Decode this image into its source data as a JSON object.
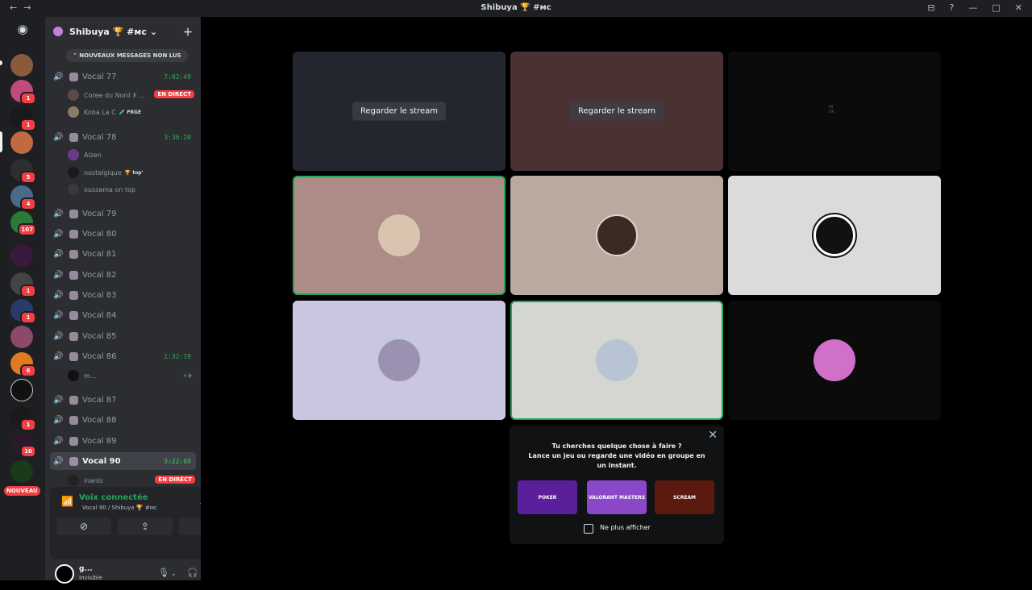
{
  "window": {
    "title": "Shibuya 🏆 #мс",
    "nav": "←→",
    "controls": [
      "⊟",
      "?",
      "—",
      "□",
      "✕"
    ]
  },
  "servers": {
    "badges": [
      "1",
      "1",
      "5",
      "4",
      "107",
      "1",
      "1",
      "6",
      "1",
      "10"
    ],
    "new_label": "NOUVEAU"
  },
  "server_header": {
    "name": "Shibuya 🏆 #мс",
    "chevron": "⌄",
    "invite_icon": "＋"
  },
  "unread_pill": "⌃ NOUVEAUX MESSAGES NON LUS",
  "channels": [
    {
      "name": "Vocal 77",
      "time": "7:02:49"
    },
    {
      "name": "Vocal 78",
      "time": "3:36:20"
    },
    {
      "name": "Vocal 79"
    },
    {
      "name": "Vocal 80"
    },
    {
      "name": "Vocal 81"
    },
    {
      "name": "Vocal 82"
    },
    {
      "name": "Vocal 83"
    },
    {
      "name": "Vocal 84"
    },
    {
      "name": "Vocal 85"
    },
    {
      "name": "Vocal 86",
      "time": "1:32:19"
    },
    {
      "name": "Vocal 87"
    },
    {
      "name": "Vocal 88"
    },
    {
      "name": "Vocal 89"
    },
    {
      "name": "Vocal 90",
      "time": "3:22:08"
    }
  ],
  "voice_users": {
    "v77": [
      {
        "name": "Coree du Nord X ...",
        "live": "EN DIRECT"
      },
      {
        "name": "Koba La C",
        "tag": "🧪 FRGE"
      }
    ],
    "v78": [
      {
        "name": "Aizen"
      },
      {
        "name": "nostalgique",
        "tag": "🏆 top'"
      },
      {
        "name": "oussama on top"
      }
    ],
    "v86": [
      {
        "name": "m...",
        "icons": "⚡✈"
      }
    ],
    "v90": [
      {
        "name": "inanis",
        "live": "EN DIRECT"
      }
    ]
  },
  "voice_panel": {
    "status": "Voix connectée",
    "sub": "Vocal 90 / Shibuya 🏆 #мс",
    "buttons": [
      "⊘",
      "⇪",
      "✥"
    ]
  },
  "user_panel": {
    "name": "g...",
    "status": "Invisible"
  },
  "stream_tiles": [
    {
      "label": "Regarder le stream"
    },
    {
      "label": "Regarder le stream"
    }
  ],
  "small_tile_label": "IN OK",
  "activity": {
    "line1": "Tu cherches quelque chose à faire ?",
    "line2": "Lance un jeu ou regarde une vidéo en groupe en un instant.",
    "games": [
      "POKER",
      "VALORANT MASTERS",
      "SCREAM"
    ],
    "dont_show": "Ne plus afficher",
    "close": "✕"
  }
}
